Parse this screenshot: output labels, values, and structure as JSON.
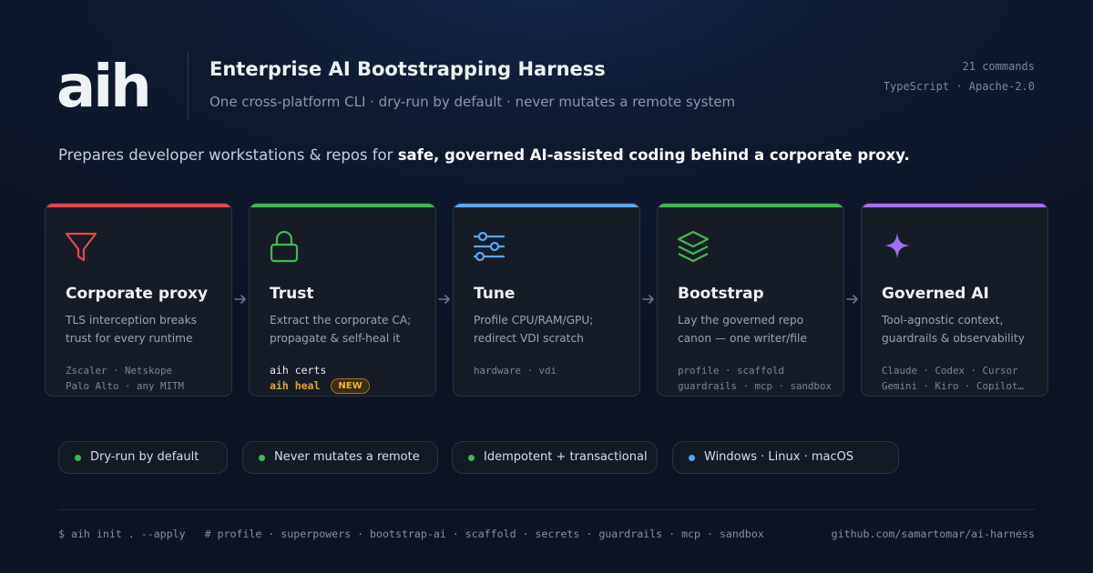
{
  "header": {
    "logo": "aih",
    "title": "Enterprise AI Bootstrapping Harness",
    "subtitle": "One cross-platform CLI · dry-run by default · never mutates a remote system",
    "meta_commands": "21 commands",
    "meta_stack": "TypeScript · Apache-2.0"
  },
  "tagline": {
    "prefix": "Prepares developer workstations & repos for ",
    "emphasis": "safe, governed AI-assisted coding behind a corporate proxy."
  },
  "cards": [
    {
      "title": "Corporate proxy",
      "description": "TLS interception breaks trust for every runtime",
      "accent": "#e5484d",
      "icon": "funnel-icon",
      "tags": [
        "Zscaler · Netskope",
        "Palo Alto · any MITM"
      ]
    },
    {
      "title": "Trust",
      "description": "Extract the corporate CA; propagate & self-heal it",
      "accent": "#3fb950",
      "icon": "lock-icon",
      "commands": [
        "aih certs",
        "aih heal"
      ],
      "badge": "NEW"
    },
    {
      "title": "Tune",
      "description": "Profile CPU/RAM/GPU; redirect VDI scratch",
      "accent": "#58a6ff",
      "icon": "sliders-icon",
      "tags": [
        "hardware · vdi"
      ]
    },
    {
      "title": "Bootstrap",
      "description": "Lay the governed repo canon — one writer/file",
      "accent": "#3fb950",
      "icon": "layers-icon",
      "tags": [
        "profile · scaffold",
        "guardrails · mcp · sandbox"
      ]
    },
    {
      "title": "Governed AI",
      "description": "Tool-agnostic context, guardrails & observability",
      "accent": "#a371f7",
      "icon": "sparkle-icon",
      "tags": [
        "Claude · Codex · Cursor",
        "Gemini · Kiro · Copilot…"
      ]
    }
  ],
  "pills": [
    {
      "label": "Dry-run by default",
      "dot": "#3fb950"
    },
    {
      "label": "Never mutates a remote",
      "dot": "#3fb950"
    },
    {
      "label": "Idempotent + transactional",
      "dot": "#3fb950"
    },
    {
      "label": "Windows · Linux · macOS",
      "dot": "#58a6ff"
    }
  ],
  "footer": {
    "command": "$ aih init . --apply",
    "comment": "# profile · superpowers · bootstrap-ai · scaffold · secrets · guardrails · mcp · sandbox",
    "repo": "github.com/samartomar/ai-harness"
  }
}
